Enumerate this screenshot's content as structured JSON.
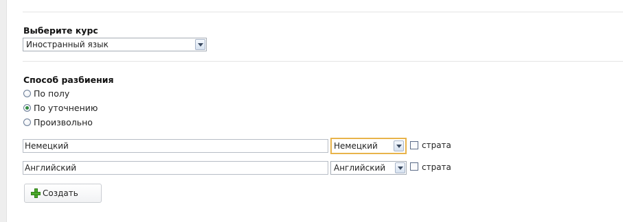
{
  "course": {
    "label": "Выберите курс",
    "selected": "Иностранный язык"
  },
  "split": {
    "label": "Способ разбиения",
    "options": [
      {
        "label": "По полу",
        "checked": false
      },
      {
        "label": "По уточнению",
        "checked": true
      },
      {
        "label": "Произвольно",
        "checked": false
      }
    ]
  },
  "groups": [
    {
      "name": "Немецкий",
      "select_value": "Немецкий",
      "checkbox_label": "страта",
      "checked": false
    },
    {
      "name": "Английский",
      "select_value": "Английский",
      "checkbox_label": "страта",
      "checked": false
    }
  ],
  "create_button": {
    "label": "Создать",
    "icon": "plus-icon"
  },
  "colors": {
    "focus_border": "#e8b34a",
    "radio_checked": "#2f8a3e",
    "plus_icon": "#4caa2c"
  }
}
